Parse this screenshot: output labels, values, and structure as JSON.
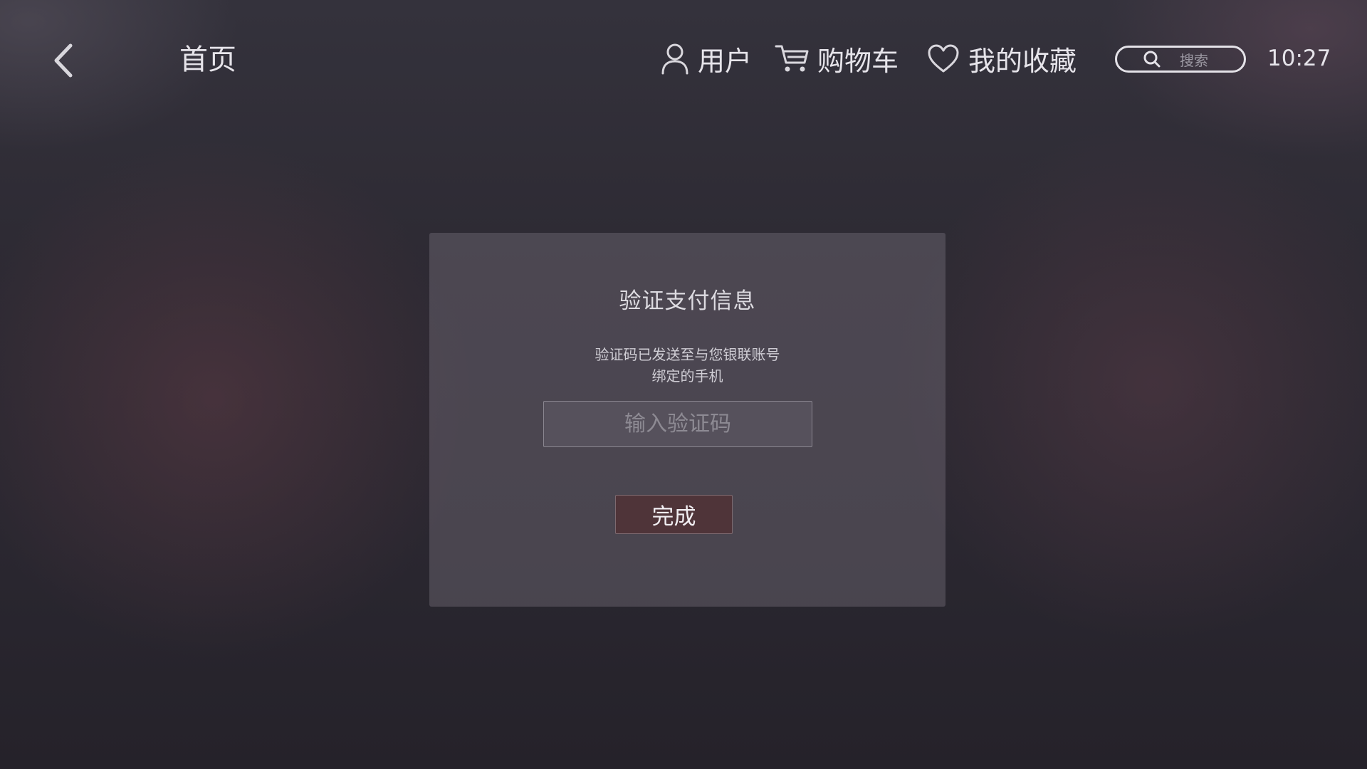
{
  "header": {
    "back_icon": "chevron-left-icon",
    "home_label": "首页",
    "nav": {
      "user": {
        "label": "用户",
        "icon": "user-icon"
      },
      "cart": {
        "label": "购物车",
        "icon": "cart-icon"
      },
      "favorites": {
        "label": "我的收藏",
        "icon": "heart-icon"
      }
    },
    "search": {
      "placeholder": "搜索",
      "icon": "search-icon"
    },
    "clock": "10:27"
  },
  "dialog": {
    "title": "验证支付信息",
    "message_line1": "验证码已发送至与您银联账号",
    "message_line2": "绑定的手机",
    "code_input": {
      "placeholder": "输入验证码",
      "value": ""
    },
    "done_label": "完成"
  },
  "colors": {
    "background": "#2d2a33",
    "dialog_bg": "#48434d",
    "button_bg": "#4f3439",
    "text": "#e6e4ea"
  }
}
